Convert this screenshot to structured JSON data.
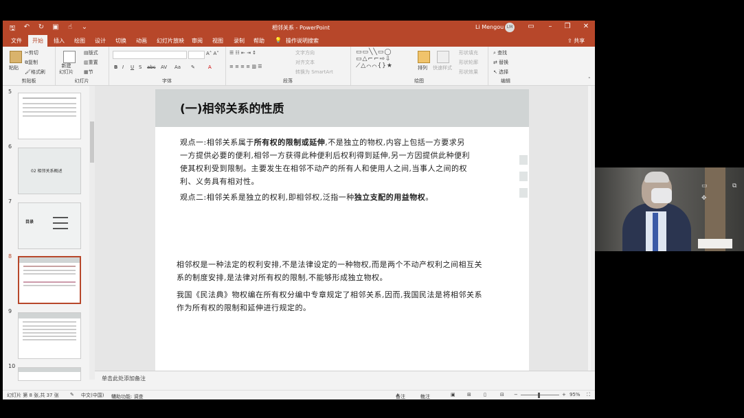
{
  "titlebar": {
    "doc_title": "相邻关系 - PowerPoint",
    "user": "Li Mengou",
    "avatar": "LM"
  },
  "tabs": [
    "文件",
    "开始",
    "插入",
    "绘图",
    "设计",
    "切换",
    "动画",
    "幻灯片放映",
    "审阅",
    "视图",
    "录制",
    "帮助"
  ],
  "active_tab": "开始",
  "search_label": "操作说明搜索",
  "share_label": "共享",
  "ribbon": {
    "clipboard": {
      "paste": "粘贴",
      "cut": "剪切",
      "copy": "复制",
      "format_painter": "格式刷",
      "label": "剪贴板"
    },
    "slides": {
      "new_slide": "新建\n幻灯片",
      "layout": "版式",
      "reset": "重置",
      "section": "节",
      "label": "幻灯片"
    },
    "font": {
      "label": "字体"
    },
    "paragraph": {
      "text_direction": "文字方向",
      "align_text": "对齐文本",
      "smartart": "转换为 SmartArt",
      "label": "段落"
    },
    "drawing": {
      "arrange": "排列",
      "quick_styles": "快速样式",
      "shape_fill": "形状填充",
      "shape_outline": "形状轮廓",
      "shape_effects": "形状效果",
      "label": "绘图"
    },
    "editing": {
      "find": "查找",
      "replace": "替换",
      "select": "选择",
      "label": "编辑"
    }
  },
  "thumbnails": [
    {
      "num": "5"
    },
    {
      "num": "6",
      "text": "02  相邻关系概述"
    },
    {
      "num": "7",
      "text": "目录"
    },
    {
      "num": "8",
      "selected": true
    },
    {
      "num": "9"
    },
    {
      "num": "10"
    }
  ],
  "slide": {
    "title": "(一)相邻关系的性质",
    "p1_a": "观点一:相邻关系属于",
    "p1_b": "所有权的限制或延伸",
    "p1_c": ",不是独立的物权,内容上包括一方要求另一方提供必要的便利,相邻一方获得此种便利后权利得到延伸,另一方因提供此种便利使其权利受到限制。主要发生在相邻不动产的所有人和使用人之间,当事人之间的权利、义务具有相对性。",
    "p2_a": "观点二:相邻关系是独立的权利,即相邻权,泛指一种",
    "p2_b": "独立支配的用益物权",
    "p2_c": "。",
    "p3": "相邻权是一种法定的权利安排,不是法律设定的一种物权,而是两个不动产权利之间相互关系的制度安排,是法律对所有权的限制,不能够形成独立物权。",
    "p4": "我国《民法典》物权编在所有权分编中专章规定了相邻关系,因而,我国民法是将相邻关系作为所有权的限制和延伸进行规定的。"
  },
  "notes_placeholder": "单击此处添加备注",
  "status": {
    "slide_info": "幻灯片 第 8 张,共 37 张",
    "language": "中文(中国)",
    "accessibility": "辅助功能: 调查",
    "notes": "备注",
    "comments": "批注",
    "zoom": "95%"
  },
  "colors": {
    "accent": "#b7472a",
    "slide_header": "#d0d4d4"
  }
}
